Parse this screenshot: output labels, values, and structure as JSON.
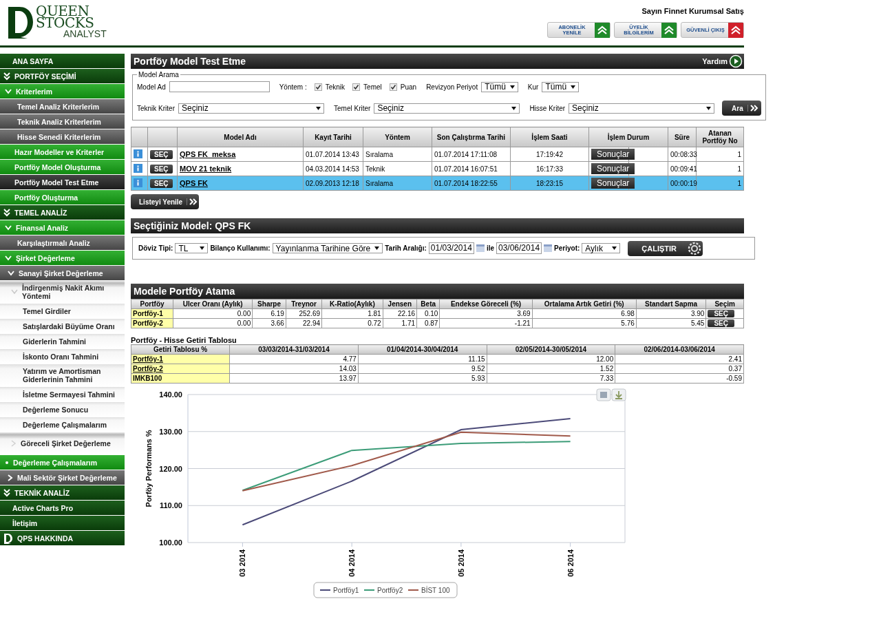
{
  "header": {
    "logo": {
      "line1": "QUEEN",
      "line2": "STOCKS",
      "line3": "ANALYST"
    },
    "greeting": "Sayın Finnet Kurumsal Satış",
    "buttons": [
      {
        "lines": [
          "ABONELİK",
          "YENİLE"
        ],
        "kind": "green"
      },
      {
        "lines": [
          "ÜYELİK",
          "BİLGİLERİM"
        ],
        "kind": "green"
      },
      {
        "lines": [
          "GÜVENLİ ÇIKIŞ"
        ],
        "kind": "red"
      }
    ]
  },
  "sidebar": {
    "items": [
      {
        "label": "ANA SAYFA",
        "kind": "section",
        "selected": false
      },
      {
        "label": "PORTFÖY SEÇİMİ",
        "kind": "section",
        "expanded": true,
        "selected": false
      },
      {
        "label": "Kriterlerim",
        "kind": "group",
        "expanded": true,
        "selected": false
      },
      {
        "label": "Temel Analiz Kriterlerim",
        "kind": "sub",
        "selected": false
      },
      {
        "label": "Teknik Analiz Kriterlerim",
        "kind": "sub",
        "selected": false
      },
      {
        "label": "Hisse Senedi Kriterlerim",
        "kind": "sub",
        "selected": false
      },
      {
        "label": "Hazır Modeller ve Kriterler",
        "kind": "group",
        "selected": false
      },
      {
        "label": "Portföy Model Oluşturma",
        "kind": "group",
        "selected": false
      },
      {
        "label": "Portföy Model Test Etme",
        "kind": "group",
        "selected": true
      },
      {
        "label": "Portföy Oluşturma",
        "kind": "group",
        "selected": false
      },
      {
        "label": "TEMEL ANALİZ",
        "kind": "section",
        "expanded": true,
        "selected": false
      },
      {
        "label": "Finansal Analiz",
        "kind": "group",
        "expanded": true,
        "selected": false
      },
      {
        "label": "Karşılaştırmalı Analiz",
        "kind": "sub",
        "selected": false
      },
      {
        "label": "Şirket Değerleme",
        "kind": "group",
        "expanded": true,
        "selected": false
      },
      {
        "label": "Sanayi Şirket Değerleme",
        "kind": "sub",
        "expanded": true,
        "selected": false
      },
      {
        "label": "İndirgenmiş Nakit Akımı Yöntemi",
        "kind": "light",
        "expanded": true,
        "selected": false
      },
      {
        "label": "Temel Girdiler",
        "kind": "leaf",
        "selected": false
      },
      {
        "label": "Satışlardaki Büyüme Oranı",
        "kind": "leaf",
        "selected": false
      },
      {
        "label": "Giderlerin Tahmini",
        "kind": "leaf",
        "selected": false
      },
      {
        "label": "İskonto Oranı Tahmini",
        "kind": "leaf",
        "selected": false
      },
      {
        "label": "Yatırım ve Amortisman Giderlerinin Tahmini",
        "kind": "leaf",
        "selected": false
      },
      {
        "label": "İsletme Sermayesi Tahmini",
        "kind": "leaf",
        "selected": false
      },
      {
        "label": "Değerleme Sonucu",
        "kind": "leaf",
        "selected": false
      },
      {
        "label": "Değerleme Çalışmalarım",
        "kind": "leaf",
        "selected": false
      },
      {
        "label": "Göreceli Şirket Değerleme",
        "kind": "light",
        "expanded": false,
        "selected": false
      },
      {
        "label": "Değerleme Çalışmalarım",
        "kind": "bulleted",
        "selected": false
      },
      {
        "label": "Mali Sektör Şirket Değerleme",
        "kind": "sub",
        "expanded": false,
        "selected": false
      },
      {
        "label": "TEKNİK ANALİZ",
        "kind": "section",
        "expanded": true,
        "selected": false
      },
      {
        "label": "Active Charts Pro",
        "kind": "section",
        "selected": false
      },
      {
        "label": "İletişim",
        "kind": "section",
        "selected": false
      },
      {
        "label": "QPS HAKKINDA",
        "kind": "brand",
        "selected": false
      }
    ]
  },
  "page": {
    "title": "Portföy Model Test Etme",
    "help": "Yardım"
  },
  "search": {
    "legend": "Model Arama",
    "model_name_label": "Model Ad",
    "method_label": "Yöntem :",
    "methods": [
      {
        "label": "Teknik",
        "checked": true
      },
      {
        "label": "Temel",
        "checked": true
      },
      {
        "label": "Puan",
        "checked": true
      }
    ],
    "period_label": "Revizyon Periyot",
    "period_value": "Tümü",
    "currency_label": "Kur",
    "currency_value": "Tümü",
    "criteria": [
      {
        "label": "Teknik Kriter",
        "value": "Seçiniz"
      },
      {
        "label": "Temel Kriter",
        "value": "Seçiniz"
      },
      {
        "label": "Hisse Kriter",
        "value": "Seçiniz"
      }
    ],
    "search_button": "Ara"
  },
  "models_table": {
    "columns": [
      "Model Adı",
      "Kayıt Tarihi",
      "Yöntem",
      "Son Çalıştırma Tarihi",
      "İşlem Saati",
      "İşlem Durum",
      "Süre",
      "Atanan Portföy No"
    ],
    "rows": [
      {
        "select": "SEÇ",
        "name": "QPS FK_meksa",
        "date": "01.07.2014 13:43",
        "method": "Sıralama",
        "last_run": "01.07.2014 17:11:08",
        "time": "17:19:42",
        "result": "Sonuçlar",
        "duration": "00:08:33",
        "portfolio_no": "1",
        "selected": false
      },
      {
        "select": "SEÇ",
        "name": "MOV 21 teknik",
        "date": "04.03.2014 14:53",
        "method": "Teknik",
        "last_run": "01.07.2014 16:07:51",
        "time": "16:17:33",
        "result": "Sonuçlar",
        "duration": "00:09:41",
        "portfolio_no": "1",
        "selected": false
      },
      {
        "select": "SEÇ",
        "name": "QPS FK",
        "date": "02.09.2013 12:18",
        "method": "Sıralama",
        "last_run": "01.07.2014 18:22:55",
        "time": "18:23:15",
        "result": "Sonuçlar",
        "duration": "00:00:19",
        "portfolio_no": "1",
        "selected": true
      }
    ]
  },
  "refresh_button": "Listeyi Yenile",
  "selected_model": {
    "title": "Seçtiğiniz Model: QPS FK",
    "currency_label": "Döviz Tipi:",
    "currency_value": "TL",
    "balance_label": "Bilanço Kullanımı:",
    "balance_value": "Yayınlanma Tarihine Göre",
    "range_label": "Tarih Aralığı:",
    "start": "01/03/2014",
    "and_label": "ile",
    "end": "03/06/2014",
    "period_label": "Periyot:",
    "period_value": "Aylık",
    "run_button": "ÇALIŞTIR"
  },
  "assignment": {
    "title": "Modele Portföy Atama",
    "columns": [
      "Portföy",
      "Ulcer Oranı (Aylık)",
      "Sharpe",
      "Treynor",
      "K-Ratio(Aylık)",
      "Jensen",
      "Beta",
      "Endekse Göreceli (%)",
      "Ortalama Artık Getiri (%)",
      "Standart Sapma",
      "Seçim"
    ],
    "rows": [
      {
        "name": "Portföy-1",
        "values": [
          "0.00",
          "6.19",
          "252.69",
          "1.81",
          "22.16",
          "0.10",
          "3.69",
          "6.98",
          "3.90"
        ],
        "select": "SEÇ"
      },
      {
        "name": "Portföy-2",
        "values": [
          "0.00",
          "3.66",
          "22.94",
          "0.72",
          "1.71",
          "0.87",
          "-1.21",
          "5.76",
          "5.45"
        ],
        "select": "SEÇ"
      }
    ]
  },
  "returns": {
    "title": "Portföy - Hisse Getiri Tablosu",
    "columns": [
      "Getiri Tablosu %",
      "03/03/2014-31/03/2014",
      "01/04/2014-30/04/2014",
      "02/05/2014-30/05/2014",
      "02/06/2014-03/06/2014"
    ],
    "rows": [
      {
        "name": "Portföy-1",
        "link": true,
        "values": [
          "4.77",
          "11.15",
          "12.00",
          "2.41"
        ]
      },
      {
        "name": "Portföy-2",
        "link": true,
        "values": [
          "14.03",
          "9.52",
          "1.52",
          "0.37"
        ]
      },
      {
        "name": "IMKB100",
        "link": false,
        "values": [
          "13.97",
          "5.93",
          "7.33",
          "-0.59"
        ]
      }
    ]
  },
  "chart": {
    "chart_data": {
      "type": "line",
      "ylabel": "Porföy Performans %",
      "categories": [
        "03 2014",
        "04 2014",
        "05 2014",
        "06 2014"
      ],
      "series": [
        {
          "name": "Portföy1",
          "color": "#4b4a78",
          "values": [
            104.8,
            116.6,
            130.5,
            133.5
          ]
        },
        {
          "name": "Portföy2",
          "color": "#3c9c78",
          "values": [
            114.1,
            124.9,
            126.8,
            127.3
          ]
        },
        {
          "name": "BİST 100",
          "color": "#a0594a",
          "values": [
            114.0,
            120.8,
            129.8,
            128.8
          ]
        }
      ],
      "ylim": [
        100,
        140
      ],
      "yticks": [
        {
          "value": 100,
          "label": "100.00"
        },
        {
          "value": 110,
          "label": "110.00"
        },
        {
          "value": 120,
          "label": "120.00"
        },
        {
          "value": 130,
          "label": "130.00"
        },
        {
          "value": 140,
          "label": "140.00"
        }
      ],
      "grid": true,
      "legend": "bottom"
    }
  }
}
